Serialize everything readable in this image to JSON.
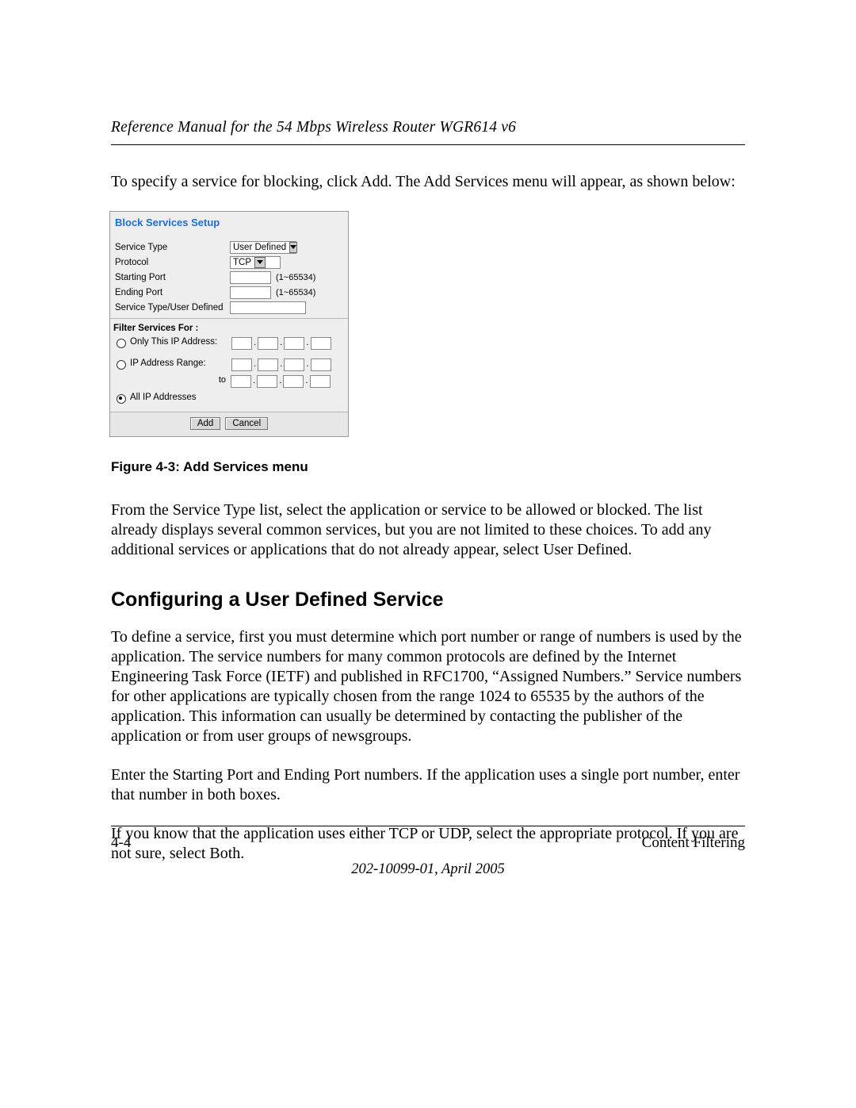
{
  "header": {
    "running_head": "Reference Manual for the 54 Mbps Wireless Router WGR614 v6"
  },
  "paragraphs": {
    "intro": "To specify a service for blocking, click Add. The Add Services menu will appear, as shown below:",
    "after_figure": "From the Service Type list, select the application or service to be allowed or blocked. The list already displays several common services, but you are not limited to these choices. To add any additional services or applications that do not already appear, select User Defined.",
    "body1": "To define a service, first you must determine which port number or range of numbers is used by the application. The service numbers for many common protocols are defined by the Internet Engineering Task Force (IETF) and published in RFC1700, “Assigned Numbers.” Service numbers for other applications are typically chosen from the range 1024 to 65535 by the authors of the application. This information can usually be determined by contacting the publisher of the application or from user groups of newsgroups.",
    "body2": "Enter the Starting Port and Ending Port numbers. If the application uses a single port number, enter that number in both boxes.",
    "body3": "If you know that the application uses either TCP or UDP, select the appropriate protocol. If you are not sure, select Both."
  },
  "figure": {
    "caption": "Figure 4-3:  Add Services menu"
  },
  "section_heading": "Configuring a User Defined Service",
  "screenshot": {
    "title": "Block Services Setup",
    "rows": {
      "service_type": {
        "label": "Service Type",
        "value": "User Defined"
      },
      "protocol": {
        "label": "Protocol",
        "value": "TCP"
      },
      "starting_port": {
        "label": "Starting Port",
        "hint": "(1~65534)"
      },
      "ending_port": {
        "label": "Ending Port",
        "hint": "(1~65534)"
      },
      "user_defined": {
        "label": "Service Type/User Defined"
      }
    },
    "filter_section": {
      "heading": "Filter Services For :",
      "only_ip": "Only This IP Address:",
      "ip_range": "IP Address Range:",
      "to": "to",
      "all_ip": "All IP Addresses"
    },
    "buttons": {
      "add": "Add",
      "cancel": "Cancel"
    }
  },
  "footer": {
    "page": "4-4",
    "section": "Content Filtering",
    "docinfo": "202-10099-01, April 2005"
  }
}
